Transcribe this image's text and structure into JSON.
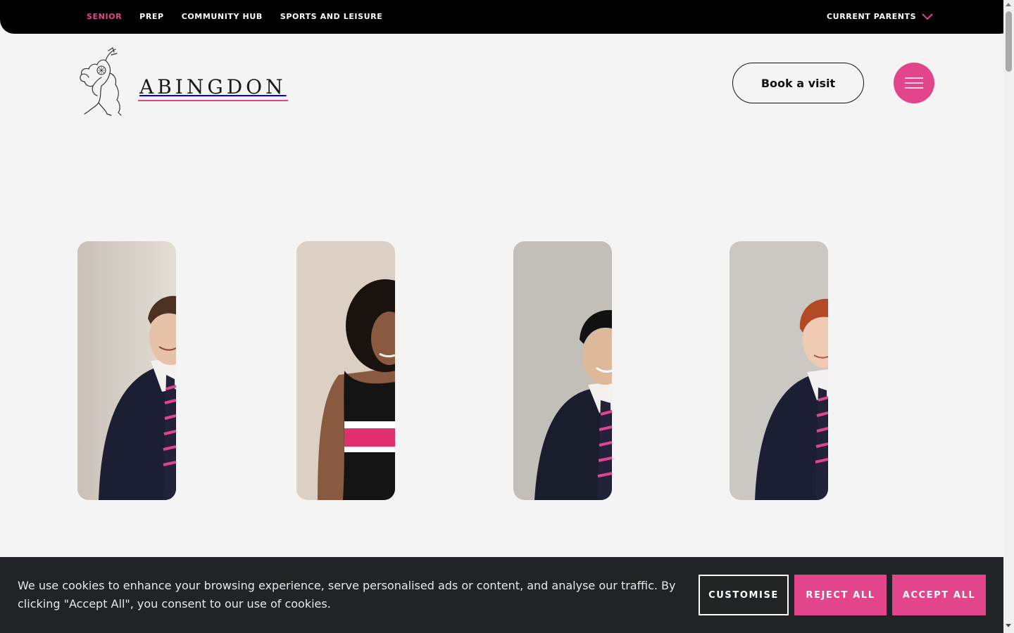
{
  "topnav": {
    "items": [
      {
        "label": "SENIOR",
        "active": true
      },
      {
        "label": "PREP",
        "active": false
      },
      {
        "label": "COMMUNITY HUB",
        "active": false
      },
      {
        "label": "SPORTS AND LEISURE",
        "active": false
      }
    ],
    "parents_label": "CURRENT PARENTS",
    "parents_icon": "chevron-down-icon"
  },
  "header": {
    "logo_text": "ABINGDON",
    "logo_icon": "griffin-crest-icon",
    "book_label": "Book a visit",
    "menu_icon": "hamburger-icon"
  },
  "portraits": [
    {
      "name": "student-portrait-1"
    },
    {
      "name": "student-portrait-2"
    },
    {
      "name": "student-portrait-3"
    },
    {
      "name": "student-portrait-4"
    }
  ],
  "cookie": {
    "message": "We use cookies to enhance your browsing experience, serve personalised ads or content, and analyse our traffic. By clicking \"Accept All\", you consent to our use of cookies.",
    "customise_label": "CUSTOMISE",
    "reject_label": "REJECT ALL",
    "accept_label": "ACCEPT ALL"
  },
  "colors": {
    "accent": "#e2458c",
    "topbar": "#000000",
    "background": "#f4f4f4",
    "banner": "#212326",
    "navy": "#1c1f33"
  }
}
